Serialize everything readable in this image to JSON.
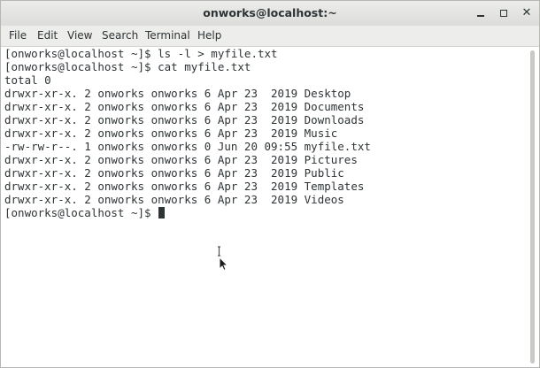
{
  "window": {
    "title": "onworks@localhost:~",
    "controls": {
      "minimize_icon": "minimize-icon",
      "maximize_icon": "maximize-icon",
      "close_icon": "close-icon",
      "close_glyph": "✕"
    }
  },
  "menubar": {
    "items": [
      {
        "label": "File"
      },
      {
        "label": "Edit"
      },
      {
        "label": "View"
      },
      {
        "label": "Search"
      },
      {
        "label": "Terminal"
      },
      {
        "label": "Help"
      }
    ]
  },
  "terminal": {
    "lines": [
      "[onworks@localhost ~]$ ls -l > myfile.txt",
      "[onworks@localhost ~]$ cat myfile.txt",
      "total 0",
      "drwxr-xr-x. 2 onworks onworks 6 Apr 23  2019 Desktop",
      "drwxr-xr-x. 2 onworks onworks 6 Apr 23  2019 Documents",
      "drwxr-xr-x. 2 onworks onworks 6 Apr 23  2019 Downloads",
      "drwxr-xr-x. 2 onworks onworks 6 Apr 23  2019 Music",
      "-rw-rw-r--. 1 onworks onworks 0 Jun 20 09:55 myfile.txt",
      "drwxr-xr-x. 2 onworks onworks 6 Apr 23  2019 Pictures",
      "drwxr-xr-x. 2 onworks onworks 6 Apr 23  2019 Public",
      "drwxr-xr-x. 2 onworks onworks 6 Apr 23  2019 Templates",
      "drwxr-xr-x. 2 onworks onworks 6 Apr 23  2019 Videos"
    ],
    "prompt": "[onworks@localhost ~]$ "
  },
  "colors": {
    "text": "#2e3436",
    "background": "#ffffff",
    "titlebar": "#e4e4e2"
  }
}
